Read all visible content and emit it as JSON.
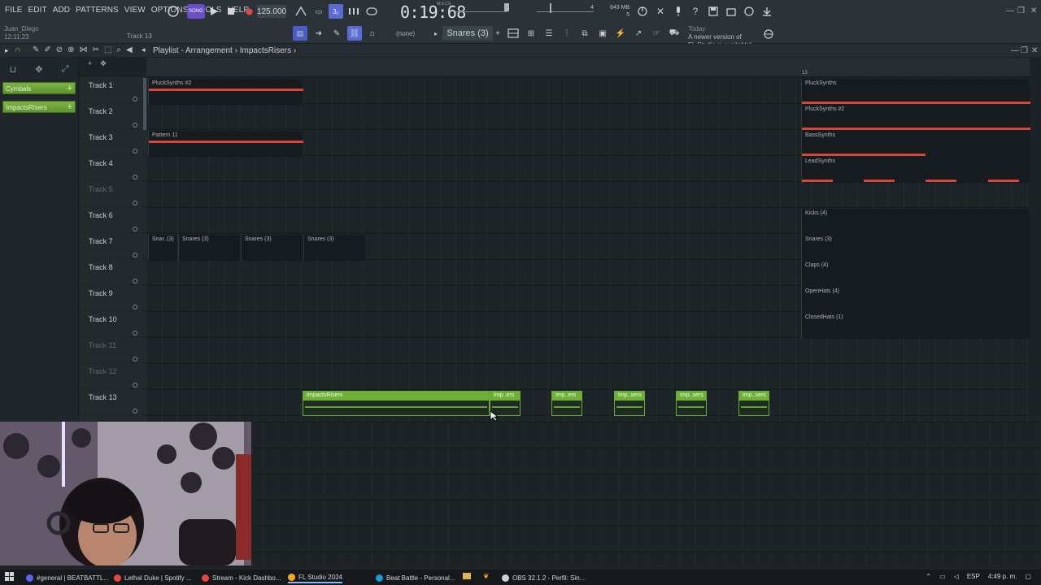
{
  "menu": [
    "FILE",
    "EDIT",
    "ADD",
    "PATTERNS",
    "VIEW",
    "OPTIONS",
    "TOOLS",
    "HELP"
  ],
  "user": {
    "name": "Juan_Diego",
    "clock": "12:11:23"
  },
  "hint_track": "Track 13",
  "transport": {
    "tempo": "125.000",
    "time": "0:19:68",
    "time_unit": "M:S:CS",
    "pattern": "Snares (3)",
    "snap": "(none)"
  },
  "status": {
    "memory": "643 MB",
    "mem_sub": "5",
    "cpu": "4"
  },
  "news": {
    "today": "Today",
    "line1": "A newer version of",
    "line2": "FL Studio is available!"
  },
  "playlist": {
    "title": "Playlist - Arrangement",
    "sep": "›",
    "current": "ImpactsRisers",
    "sep2": "›"
  },
  "ruler_marker": "13",
  "picker": [
    {
      "name": "Cymbals",
      "plus": "+"
    },
    {
      "name": "ImpactsRisers",
      "plus": "+"
    }
  ],
  "tracks": [
    "Track 1",
    "Track 2",
    "Track 3",
    "Track 4",
    "Track 5",
    "Track 6",
    "Track 7",
    "Track 8",
    "Track 9",
    "Track 10",
    "Track 11",
    "Track 12",
    "Track 13"
  ],
  "clips": {
    "c1": "PluckSynths #2",
    "c2": "Pattern 11",
    "c3": "Snar..(3)",
    "c4": "Snares (3)",
    "c5": "Snares (3)",
    "c6": "Snares (3)",
    "r1": "PluckSynths",
    "r2": "PluckSynths #2",
    "r3": "BassSynths",
    "r4": "LeadSynths",
    "r5": "Kicks (4)",
    "r6": "Snares (3)",
    "r7": "Claps (4)",
    "r8": "OpenHats (4)",
    "r9": "ClosedHats (1)",
    "a1": "ImpactsRisers",
    "a2": "Imp..ers",
    "a3": "Imp..ers",
    "a4": "Imp..sers",
    "a5": "Imp..sers",
    "a6": "Imp..sers"
  },
  "taskbar": [
    {
      "label": "#general | BEATBATTL...",
      "color": "#5865f2"
    },
    {
      "label": "Lethal Duke | Spotify ...",
      "color": "#e8453c"
    },
    {
      "label": "Stream - Kick Dashbo...",
      "color": "#e8453c"
    },
    {
      "label": "FL Studio 2024",
      "color": "#f4a81d"
    },
    {
      "label": "Beat Battle - Personal...",
      "color": "#1a9bd7"
    },
    {
      "label": "OBS 32.1.2 - Perfil: Sin...",
      "color": "#d0d0d0"
    }
  ],
  "tray": {
    "lang": "ESP",
    "clock": "4:49 p. m."
  },
  "colors": {
    "note": "#d8463a",
    "automation": "#6cb035",
    "picker": "#7db242"
  }
}
